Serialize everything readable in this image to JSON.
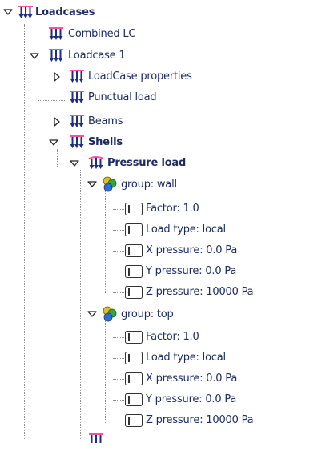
{
  "tree": {
    "root": {
      "label": "Loadcases",
      "expanded": true,
      "icon": "load-arrows-icon"
    },
    "combined": {
      "label": "Combined LC",
      "icon": "load-arrows-icon"
    },
    "loadcase1": {
      "label": "Loadcase 1",
      "expanded": true,
      "icon": "load-arrows-icon"
    },
    "properties": {
      "label": "LoadCase properties",
      "expanded": false,
      "icon": "load-arrows-icon"
    },
    "punctual": {
      "label": "Punctual load",
      "icon": "load-arrows-icon"
    },
    "beams": {
      "label": "Beams",
      "expanded": false,
      "icon": "load-arrows-icon"
    },
    "shells": {
      "label": "Shells",
      "expanded": true,
      "icon": "load-arrows-icon"
    },
    "pressure": {
      "label": "Pressure load",
      "expanded": true,
      "icon": "pressure-load-icon"
    },
    "groups": [
      {
        "label": "group: wall",
        "expanded": true,
        "icon": "group-spheres-icon",
        "items": [
          {
            "label": "Factor: 1.0",
            "icon": "parameter-icon"
          },
          {
            "label": "Load type: local",
            "icon": "parameter-icon"
          },
          {
            "label": "X pressure: 0.0 Pa",
            "icon": "parameter-icon"
          },
          {
            "label": "Y pressure: 0.0 Pa",
            "icon": "parameter-icon"
          },
          {
            "label": "Z pressure: 10000 Pa",
            "icon": "parameter-icon"
          }
        ]
      },
      {
        "label": "group: top",
        "expanded": true,
        "icon": "group-spheres-icon",
        "items": [
          {
            "label": "Factor: 1.0",
            "icon": "parameter-icon"
          },
          {
            "label": "Load type: local",
            "icon": "parameter-icon"
          },
          {
            "label": "X pressure: 0.0 Pa",
            "icon": "parameter-icon"
          },
          {
            "label": "Y pressure: 0.0 Pa",
            "icon": "parameter-icon"
          },
          {
            "label": "Z pressure: 10000 Pa",
            "icon": "parameter-icon"
          }
        ]
      }
    ]
  },
  "colors": {
    "text": "#1d2b62",
    "load_icon_pink": "#ff4fa0",
    "load_icon_navy": "#1f2f80",
    "tree_line": "#8a8a8a"
  }
}
